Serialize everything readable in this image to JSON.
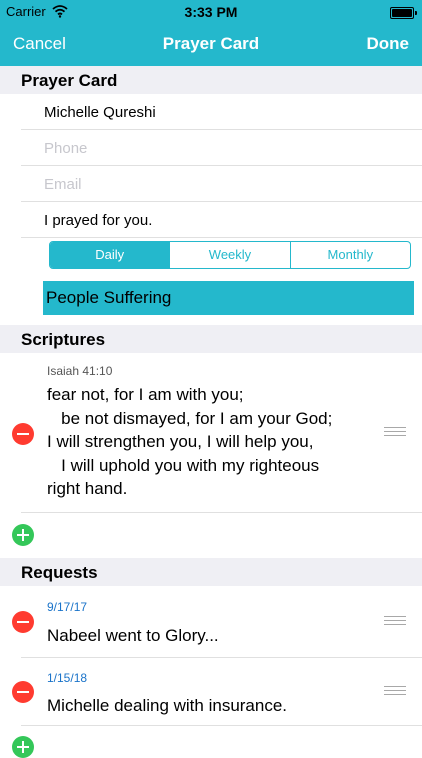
{
  "status_bar": {
    "carrier": "Carrier",
    "time": "3:33 PM"
  },
  "nav": {
    "cancel_label": "Cancel",
    "title": "Prayer Card",
    "done_label": "Done"
  },
  "prayer_card": {
    "header": "Prayer Card",
    "name": "Michelle Qureshi",
    "phone_placeholder": "Phone",
    "email_placeholder": "Email",
    "message": "I prayed for you.",
    "frequency_options": [
      "Daily",
      "Weekly",
      "Monthly"
    ],
    "frequency_selected": "Daily",
    "category": "People Suffering"
  },
  "scriptures": {
    "header": "Scriptures",
    "items": [
      {
        "reference": "Isaiah 41:10",
        "text": "fear not, for I am with you;\n   be not dismayed, for I am your God;\nI will strengthen you, I will help you,\n   I will uphold you with my righteous\nright hand."
      }
    ]
  },
  "requests": {
    "header": "Requests",
    "items": [
      {
        "date": "9/17/17",
        "text": "Nabeel went to Glory..."
      },
      {
        "date": "1/15/18",
        "text": "Michelle dealing with insurance."
      }
    ]
  },
  "colors": {
    "accent": "#24b8cc",
    "delete": "#ff3b30",
    "add": "#34c759",
    "date": "#1a73c9"
  },
  "icons": [
    "wifi-icon",
    "battery-icon",
    "delete-icon",
    "add-icon",
    "reorder-icon"
  ]
}
